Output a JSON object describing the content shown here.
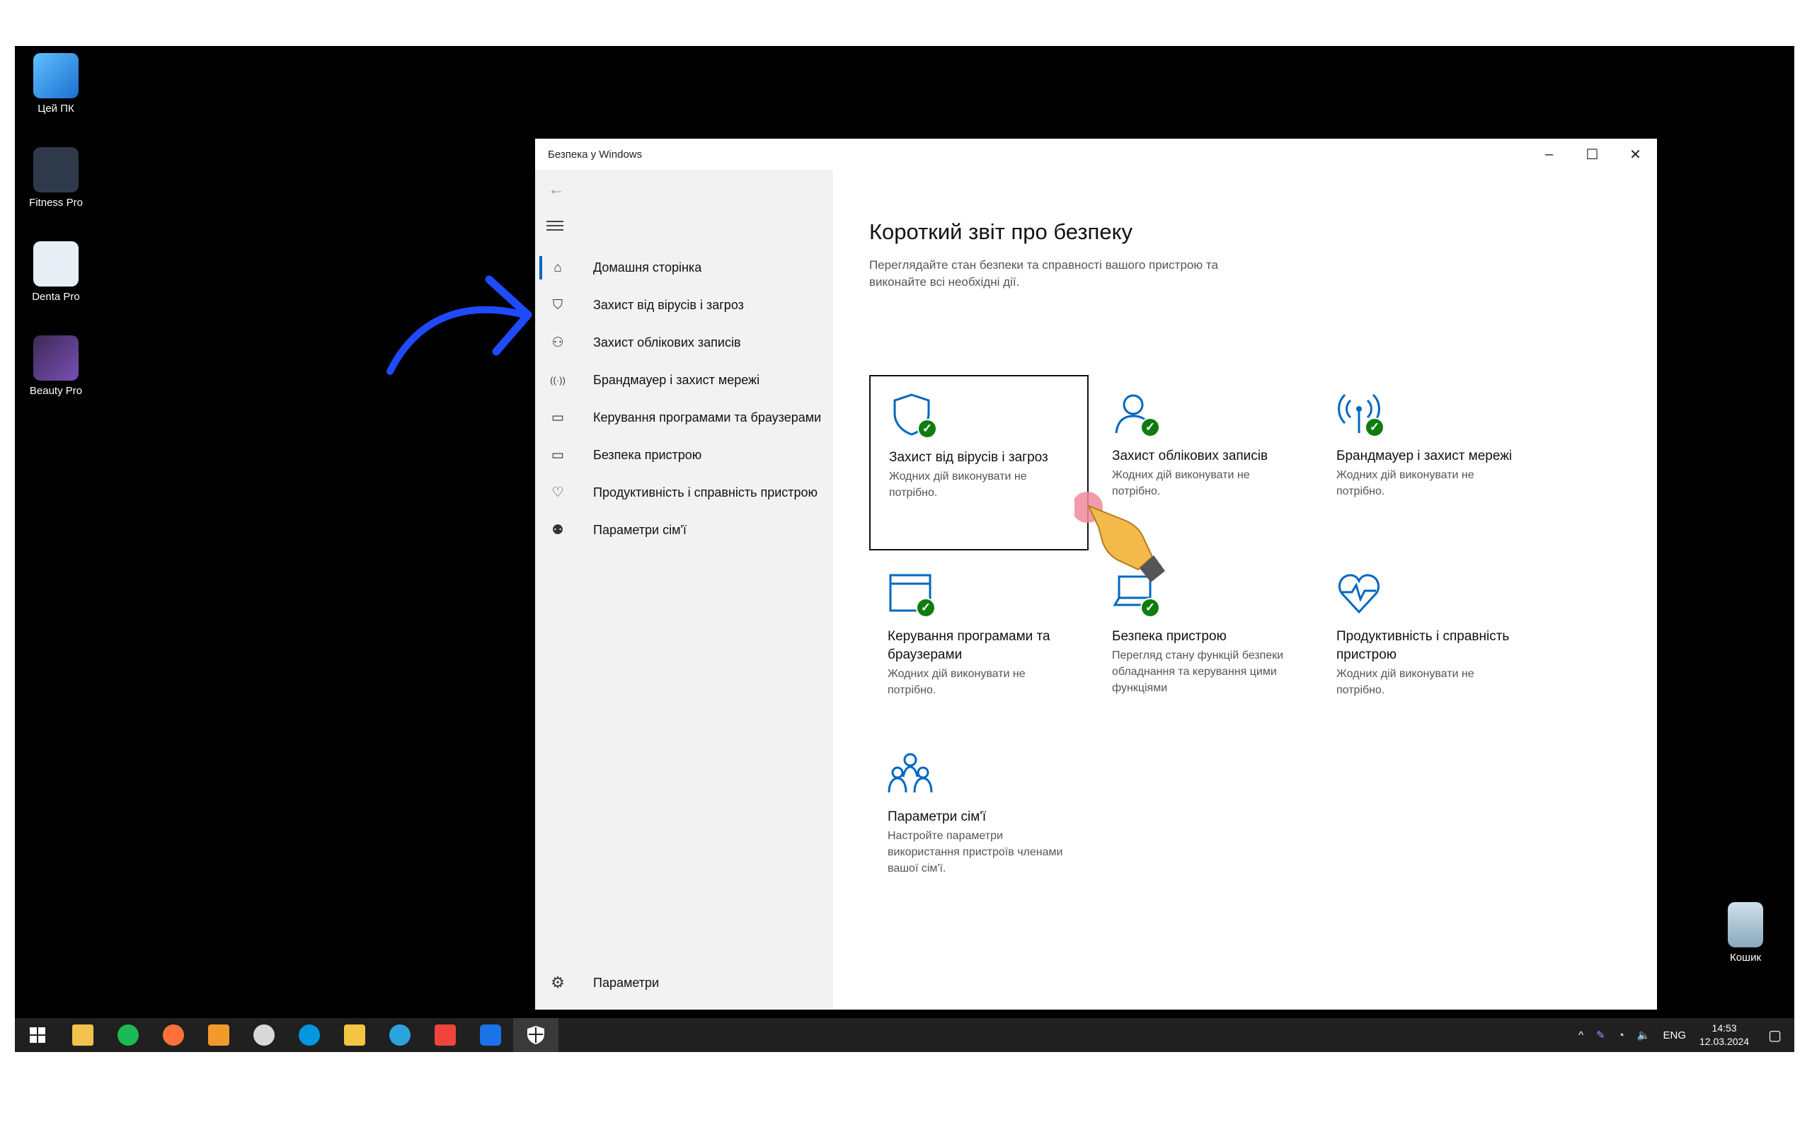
{
  "desktop": {
    "icons": [
      {
        "label": "Цей ПК",
        "icon": "computer-icon",
        "color": "#3aa0f0"
      },
      {
        "label": "Fitness Pro",
        "icon": "fitness-app-icon",
        "color": "#2e3a4a"
      },
      {
        "label": "Denta Pro",
        "icon": "tooth-app-icon",
        "color": "#e8eef5"
      },
      {
        "label": "Beauty Pro",
        "icon": "beauty-app-icon",
        "color": "#3c2a55"
      },
      {
        "label": "Кошик",
        "icon": "recycle-bin-icon",
        "color": "#9ab8cc"
      }
    ]
  },
  "window": {
    "title": "Безпека у Windows",
    "controls": {
      "minimize": "–",
      "maximize": "☐",
      "close": "✕"
    }
  },
  "sidebar": {
    "back_icon": "←",
    "items": [
      {
        "label": "Домашня сторінка",
        "icon": "⌂",
        "active": true
      },
      {
        "label": "Захист від вірусів і загроз",
        "icon": "⛉"
      },
      {
        "label": "Захист облікових записів",
        "icon": "⚇"
      },
      {
        "label": "Брандмауер і захист мережі",
        "icon": "((·))"
      },
      {
        "label": "Керування програмами та браузерами",
        "icon": "▭"
      },
      {
        "label": "Безпека пристрою",
        "icon": "▭"
      },
      {
        "label": "Продуктивність і справність пристрою",
        "icon": "♡"
      },
      {
        "label": "Параметри сім'ї",
        "icon": "⚉"
      }
    ],
    "settings_label": "Параметри",
    "settings_icon": "⚙"
  },
  "main": {
    "title": "Короткий звіт про безпеку",
    "subtitle": "Переглядайте стан безпеки та справності вашого пристрою та виконайте всі необхідні дії.",
    "tiles": [
      {
        "name": "Захист від вірусів і загроз",
        "desc": "Жодних дій виконувати не потрібно.",
        "icon": "shield-icon",
        "status": "ok"
      },
      {
        "name": "Захист облікових записів",
        "desc": "Жодних дій виконувати не потрібно.",
        "icon": "account-icon",
        "status": "ok"
      },
      {
        "name": "Брандмауер і захист мережі",
        "desc": "Жодних дій виконувати не потрібно.",
        "icon": "antenna-icon",
        "status": "ok"
      },
      {
        "name": "Керування програмами та браузерами",
        "desc": "Жодних дій виконувати не потрібно.",
        "icon": "browser-icon",
        "status": "ok"
      },
      {
        "name": "Безпека пристрою",
        "desc": "Перегляд стану функцій безпеки обладнання та керування цими функціями",
        "icon": "laptop-icon",
        "status": "ok"
      },
      {
        "name": "Продуктивність і справність пристрою",
        "desc": "Жодних дій виконувати не потрібно.",
        "icon": "heart-icon",
        "status": "none"
      },
      {
        "name": "Параметри сім'ї",
        "desc": "Настройте параметри використання пристроїв членами вашої сім'ї.",
        "icon": "family-icon",
        "status": "none"
      }
    ]
  },
  "taskbar": {
    "apps": [
      {
        "name": "start-button",
        "color": "#ffffff"
      },
      {
        "name": "file-explorer-icon",
        "color": "#f2c14e"
      },
      {
        "name": "spotify-icon",
        "color": "#1db954"
      },
      {
        "name": "firefox-icon",
        "color": "#ff7139"
      },
      {
        "name": "sublime-icon",
        "color": "#f49a2a"
      },
      {
        "name": "chrome-icon",
        "color": "#d8d8d8"
      },
      {
        "name": "skype-icon",
        "color": "#0096e0"
      },
      {
        "name": "notes-icon",
        "color": "#f4c542"
      },
      {
        "name": "telegram-icon",
        "color": "#2aa3df"
      },
      {
        "name": "anydesk-icon",
        "color": "#ef443b"
      },
      {
        "name": "screen-share-icon",
        "color": "#1a73e8"
      },
      {
        "name": "defender-icon",
        "color": "#ffffff",
        "active": true
      }
    ],
    "tray": {
      "chevron": "^",
      "pen": "✎",
      "network": "◔",
      "volume": "🔈",
      "lang": "ENG",
      "time": "14:53",
      "date": "12.03.2024",
      "notifications": "▢"
    }
  },
  "colors": {
    "accent": "#0067c0",
    "ok_green": "#107c10",
    "tile_icon": "#0067c0",
    "annotation_arrow": "#1f4bff"
  }
}
